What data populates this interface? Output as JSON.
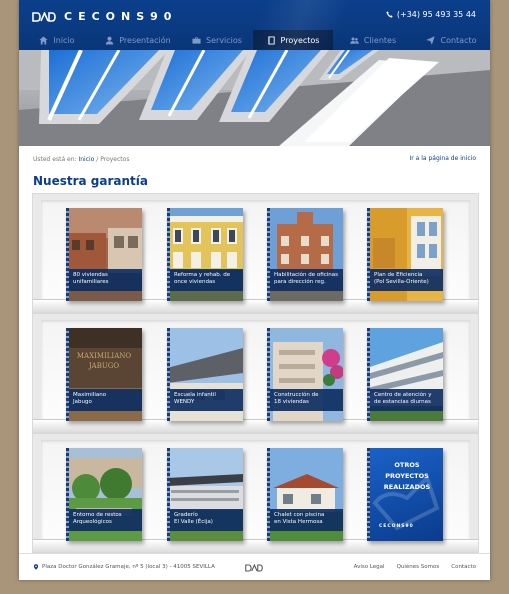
{
  "header": {
    "logo_text": "CECONS90",
    "phone": "(+34) 95 493 35 44"
  },
  "nav": {
    "items": [
      {
        "label": "Inicio",
        "icon": "home-icon"
      },
      {
        "label": "Presentación",
        "icon": "user-icon"
      },
      {
        "label": "Servicios",
        "icon": "briefcase-icon"
      },
      {
        "label": "Proyectos",
        "icon": "book-icon",
        "active": true
      },
      {
        "label": "Clientes",
        "icon": "users-icon"
      },
      {
        "label": "Contacto",
        "icon": "send-icon"
      }
    ]
  },
  "breadcrumb": {
    "prefix": "Usted está en:",
    "home": "Inicio",
    "separator": "/",
    "current": "Proyectos",
    "home_page_link": "Ir a la página de inicio"
  },
  "page_title": "Nuestra garantía",
  "projects": [
    {
      "line1": "80 viviendas",
      "line2": "unifamiliares"
    },
    {
      "line1": "Reforma y rehab. de",
      "line2": "once viviendas"
    },
    {
      "line1": "Habilitación de oficinas",
      "line2": "para dirección reg."
    },
    {
      "line1": "Plan de Eficiencia",
      "line2": "(Pol Sevilla-Oriente)"
    },
    {
      "line1": "Maximiliano",
      "line2": "Jabugo"
    },
    {
      "line1": "Escuela infantil",
      "line2": "WENDY"
    },
    {
      "line1": "Construcción de",
      "line2": "18 viviendas"
    },
    {
      "line1": "Centro de atención y",
      "line2": "de estancias diurnas"
    },
    {
      "line1": "Entorno de restos",
      "line2": "Arqueológicos"
    },
    {
      "line1": "Graderío",
      "line2": "El Valle (Écija)"
    },
    {
      "line1": "Chalet con piscina",
      "line2": "en Vista Hermosa"
    }
  ],
  "other_projects": {
    "line1": "OTROS",
    "line2": "PROYECTOS",
    "line3": "REALIZADOS",
    "logo": "CECONS90"
  },
  "sign_text": {
    "line1": "MAXIMILIANO",
    "line2": "JABUGO"
  },
  "footer": {
    "address": "Plaza Doctor González Gramaje, nº 5 (local 3) - 41005 SEVILLA",
    "links": [
      "Aviso Legal",
      "Quiénes Somos",
      "Contacto"
    ]
  },
  "colors": {
    "brand_blue": "#0b3f8c",
    "nav_active": "#08234f",
    "page_background": "#a8957a"
  }
}
